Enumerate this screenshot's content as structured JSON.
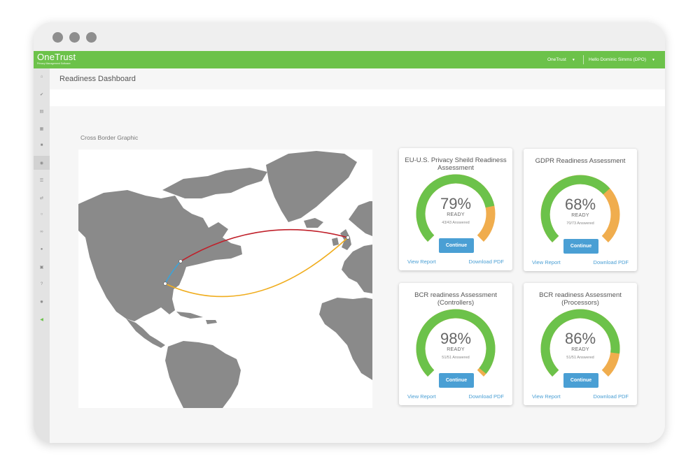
{
  "app": {
    "brand": "OneTrust",
    "tagline": "Privacy Management Software",
    "org_selector": "OneTrust",
    "user_greeting": "Hello Dominic Simms (DPO)"
  },
  "colors": {
    "brand_green": "#6cc24a",
    "gauge_green": "#6cc24a",
    "gauge_orange": "#f0ad4e",
    "link_blue": "#4a9fd4",
    "route_red": "#c0202a",
    "route_orange": "#f0ad1e",
    "route_blue": "#3ba3d8"
  },
  "sidebar": {
    "items": [
      {
        "icon": "home-icon"
      },
      {
        "icon": "check-icon"
      },
      {
        "icon": "document-icon"
      },
      {
        "icon": "grid-icon"
      },
      {
        "icon": "briefcase-icon"
      },
      {
        "icon": "globe-icon",
        "active": true
      },
      {
        "icon": "list-icon"
      },
      {
        "icon": "shuffle-icon"
      },
      {
        "icon": "cloud-icon"
      },
      {
        "icon": "link-icon"
      },
      {
        "icon": "user-icon"
      },
      {
        "icon": "users-icon"
      },
      {
        "icon": "help-icon"
      },
      {
        "icon": "settings-icon"
      },
      {
        "icon": "megaphone-icon",
        "highlight": true
      }
    ]
  },
  "page": {
    "title": "Readiness Dashboard",
    "section_label": "Cross Border Graphic"
  },
  "cards": [
    {
      "title": "EU-U.S. Privacy Sheild Readiness Assessment",
      "percent": "79%",
      "ready_fraction": 0.79,
      "ready_label": "READY",
      "answered": "43/43 Answered",
      "continue": "Continue",
      "view_report": "View Report",
      "download_pdf": "Download PDF"
    },
    {
      "title": "GDPR Readiness Assessment",
      "percent": "68%",
      "ready_fraction": 0.68,
      "ready_label": "READY",
      "answered": "70/73 Answered",
      "continue": "Continue",
      "view_report": "View Report",
      "download_pdf": "Download PDF"
    },
    {
      "title": "BCR readiness Assessment (Controllers)",
      "percent": "98%",
      "ready_fraction": 0.98,
      "ready_label": "READY",
      "answered": "51/51 Answered",
      "continue": "Continue",
      "view_report": "View Report",
      "download_pdf": "Download PDF"
    },
    {
      "title": "BCR readiness Assessment (Processors)",
      "percent": "86%",
      "ready_fraction": 0.86,
      "ready_label": "READY",
      "answered": "51/51 Answered",
      "continue": "Continue",
      "view_report": "View Report",
      "download_pdf": "Download PDF"
    }
  ]
}
